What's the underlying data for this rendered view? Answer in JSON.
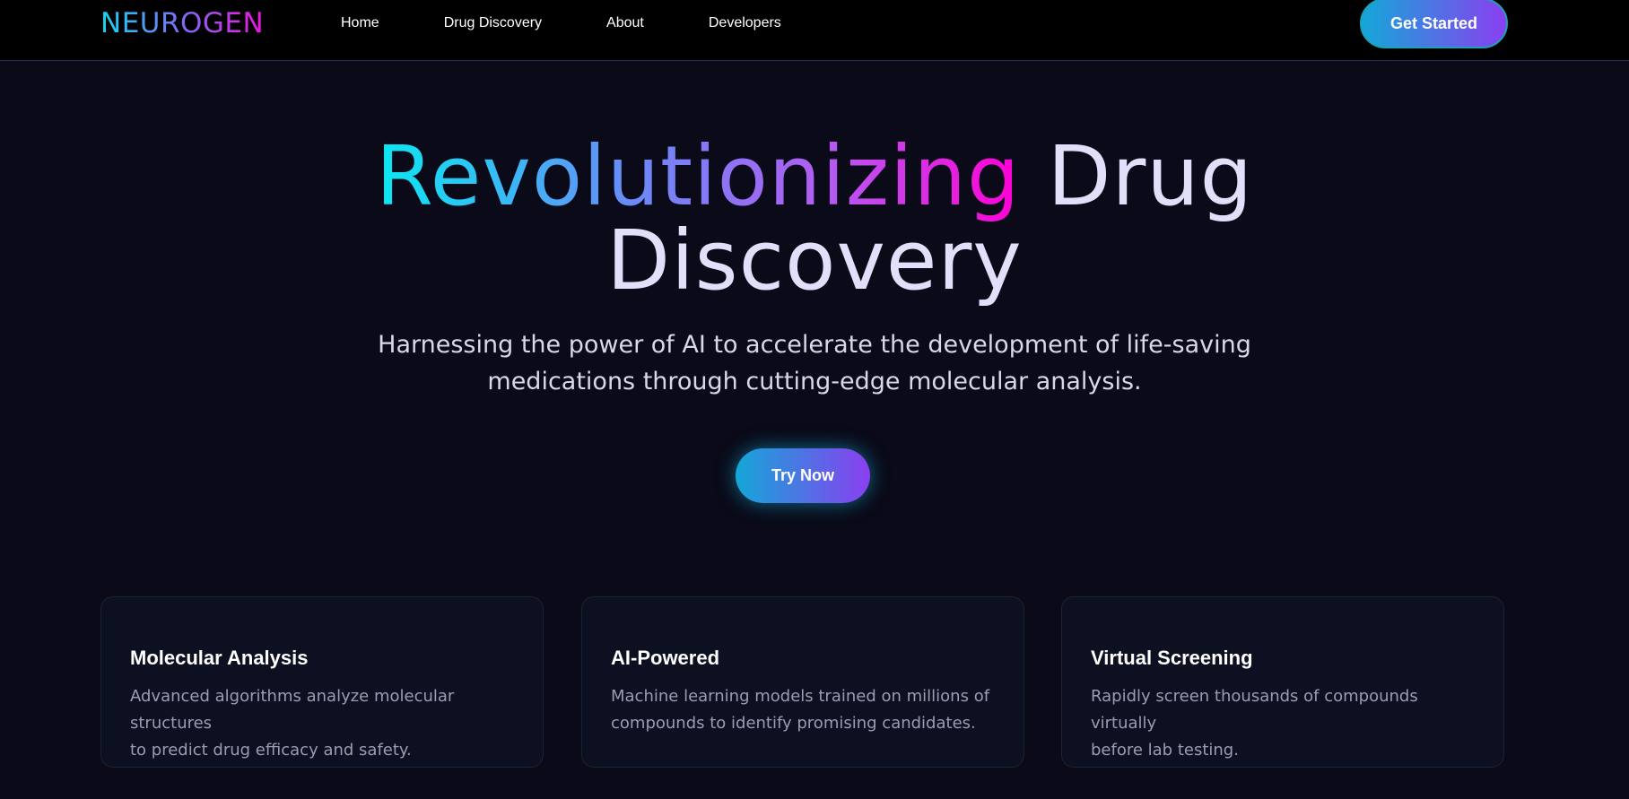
{
  "brand": {
    "logo_text": "NEUROGEN"
  },
  "nav": {
    "items": [
      {
        "label": "Home"
      },
      {
        "label": "Drug Discovery"
      },
      {
        "label": "About"
      },
      {
        "label": "Developers"
      }
    ],
    "cta_label": "Get Started"
  },
  "hero": {
    "title_highlight": "Revolutionizing",
    "title_rest_line1": " Drug",
    "title_line2": "Discovery",
    "subtitle_line1": "Harnessing the power of AI to accelerate the development of life-saving",
    "subtitle_line2": "medications through cutting-edge molecular analysis.",
    "button_label": "Try Now"
  },
  "features": [
    {
      "title": "Molecular Analysis",
      "desc_line1": "Advanced algorithms analyze molecular structures",
      "desc_line2": "to predict drug efficacy and safety."
    },
    {
      "title": "AI-Powered",
      "desc_line1": "Machine learning models trained on millions of",
      "desc_line2": "compounds to identify promising candidates."
    },
    {
      "title": "Virtual Screening",
      "desc_line1": "Rapidly screen thousands of compounds virtually",
      "desc_line2": "before lab testing."
    }
  ],
  "colors": {
    "background": "#0a0a18",
    "navbar": "#000000",
    "gradient_start": "#14a7d8",
    "gradient_end": "#8a3ff0",
    "title_pink": "#ff00d4",
    "title_cyan": "#0ae8f2"
  }
}
